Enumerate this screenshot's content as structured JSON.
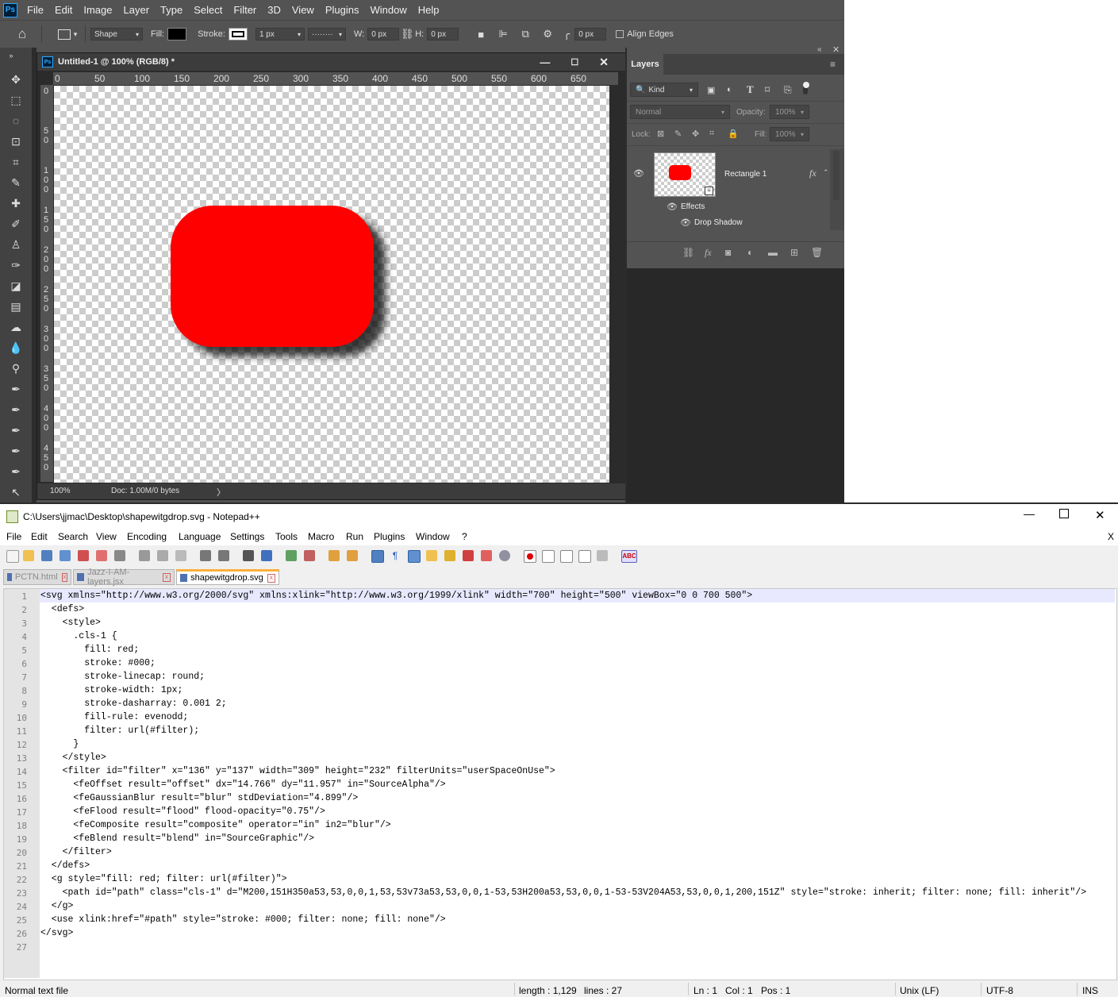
{
  "photoshop": {
    "logo": "Ps",
    "menu": [
      "File",
      "Edit",
      "Image",
      "Layer",
      "Type",
      "Select",
      "Filter",
      "3D",
      "View",
      "Plugins",
      "Window",
      "Help"
    ],
    "options": {
      "mode": "Shape",
      "fill_label": "Fill:",
      "stroke_label": "Stroke:",
      "stroke_width": "1 px",
      "stroke_style": "········",
      "w_label": "W:",
      "w_value": "0 px",
      "h_label": "H:",
      "h_value": "0 px",
      "corner_radius": "0 px",
      "align_edges": "Align Edges",
      "fill_color": "#000000"
    },
    "document": {
      "title": "Untitled-1 @ 100% (RGB/8) *",
      "ruler_top": [
        "0",
        "50",
        "100",
        "150",
        "200",
        "250",
        "300",
        "350",
        "400",
        "450",
        "500",
        "550",
        "600",
        "650"
      ],
      "ruler_left": [
        "0",
        "5\n0",
        "1\n0\n0",
        "1\n5\n0",
        "2\n0\n0",
        "2\n5\n0",
        "3\n0\n0",
        "3\n5\n0",
        "4\n0\n0",
        "4\n5\n0"
      ],
      "zoom": "100%",
      "doc_info": "Doc: 1.00M/0 bytes",
      "shape_color": "#ff0000"
    },
    "layers_panel": {
      "tab": "Layers",
      "filter_kind": "Kind",
      "blend_mode": "Normal",
      "opacity_label": "Opacity:",
      "opacity_value": "100%",
      "lock_label": "Lock:",
      "fill_label": "Fill:",
      "fill_value": "100%",
      "layer_name": "Rectangle 1",
      "fx": "fx",
      "effects_label": "Effects",
      "effect_item": "Drop Shadow"
    }
  },
  "notepad": {
    "title": "C:\\Users\\jjmac\\Desktop\\shapewitgdrop.svg - Notepad++",
    "menu": [
      "File",
      "Edit",
      "Search",
      "View",
      "Encoding",
      "Language",
      "Settings",
      "Tools",
      "Macro",
      "Run",
      "Plugins",
      "Window",
      "?"
    ],
    "close_x": "X",
    "tabs": [
      {
        "label": "PCTN.html",
        "active": false
      },
      {
        "label": "Jazz-I-AM-layers.jsx",
        "active": false
      },
      {
        "label": "shapewitgdrop.svg",
        "active": true
      }
    ],
    "lines": [
      "<svg xmlns=\"http://www.w3.org/2000/svg\" xmlns:xlink=\"http://www.w3.org/1999/xlink\" width=\"700\" height=\"500\" viewBox=\"0 0 700 500\">",
      "  <defs>",
      "    <style>",
      "      .cls-1 {",
      "        fill: red;",
      "        stroke: #000;",
      "        stroke-linecap: round;",
      "        stroke-width: 1px;",
      "        stroke-dasharray: 0.001 2;",
      "        fill-rule: evenodd;",
      "        filter: url(#filter);",
      "      }",
      "    </style>",
      "    <filter id=\"filter\" x=\"136\" y=\"137\" width=\"309\" height=\"232\" filterUnits=\"userSpaceOnUse\">",
      "      <feOffset result=\"offset\" dx=\"14.766\" dy=\"11.957\" in=\"SourceAlpha\"/>",
      "      <feGaussianBlur result=\"blur\" stdDeviation=\"4.899\"/>",
      "      <feFlood result=\"flood\" flood-opacity=\"0.75\"/>",
      "      <feComposite result=\"composite\" operator=\"in\" in2=\"blur\"/>",
      "      <feBlend result=\"blend\" in=\"SourceGraphic\"/>",
      "    </filter>",
      "  </defs>",
      "  <g style=\"fill: red; filter: url(#filter)\">",
      "    <path id=\"path\" class=\"cls-1\" d=\"M200,151H350a53,53,0,0,1,53,53v73a53,53,0,0,1-53,53H200a53,53,0,0,1-53-53V204A53,53,0,0,1,200,151Z\" style=\"stroke: inherit; filter: none; fill: inherit\"/>",
      "  </g>",
      "  <use xlink:href=\"#path\" style=\"stroke: #000; filter: none; fill: none\"/>",
      "</svg>",
      ""
    ],
    "status": {
      "type": "Normal text file",
      "length": "length : 1,129",
      "lines": "lines : 27",
      "ln": "Ln : 1",
      "col": "Col : 1",
      "pos": "Pos : 1",
      "eol": "Unix (LF)",
      "encoding": "UTF-8",
      "ins": "INS"
    }
  }
}
